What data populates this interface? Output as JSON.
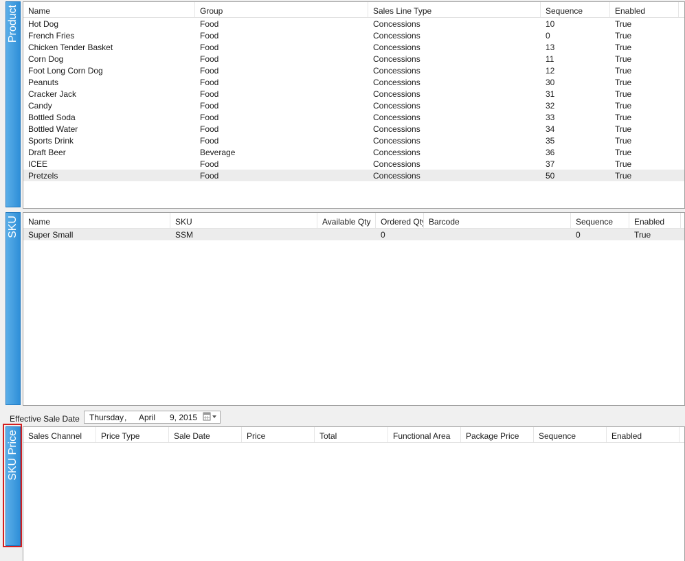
{
  "product": {
    "tab_label": "Product",
    "columns": [
      "Name",
      "Group",
      "Sales Line Type",
      "Sequence",
      "Enabled"
    ],
    "rows": [
      [
        "Hot Dog",
        "Food",
        "Concessions",
        "10",
        "True"
      ],
      [
        "French Fries",
        "Food",
        "Concessions",
        "0",
        "True"
      ],
      [
        "Chicken Tender Basket",
        "Food",
        "Concessions",
        "13",
        "True"
      ],
      [
        "Corn Dog",
        "Food",
        "Concessions",
        "11",
        "True"
      ],
      [
        "Foot Long Corn Dog",
        "Food",
        "Concessions",
        "12",
        "True"
      ],
      [
        "Peanuts",
        "Food",
        "Concessions",
        "30",
        "True"
      ],
      [
        "Cracker Jack",
        "Food",
        "Concessions",
        "31",
        "True"
      ],
      [
        "Candy",
        "Food",
        "Concessions",
        "32",
        "True"
      ],
      [
        "Bottled Soda",
        "Food",
        "Concessions",
        "33",
        "True"
      ],
      [
        "Bottled Water",
        "Food",
        "Concessions",
        "34",
        "True"
      ],
      [
        "Sports Drink",
        "Food",
        "Concessions",
        "35",
        "True"
      ],
      [
        "Draft Beer",
        "Beverage",
        "Concessions",
        "36",
        "True"
      ],
      [
        "ICEE",
        "Food",
        "Concessions",
        "37",
        "True"
      ],
      [
        "Pretzels",
        "Food",
        "Concessions",
        "50",
        "True"
      ]
    ],
    "selected_row": 13
  },
  "sku": {
    "tab_label": "SKU",
    "columns": [
      "Name",
      "SKU",
      "Available Qty",
      "Ordered Qty",
      "Barcode",
      "Sequence",
      "Enabled"
    ],
    "rows": [
      [
        "Super Small",
        "SSM",
        "",
        "0",
        "",
        "0",
        "True"
      ]
    ],
    "selected_row": 0
  },
  "effective_sale_date": {
    "label": "Effective Sale Date",
    "weekday": "Thursday",
    "separator": ",",
    "month": "April",
    "day_year": "9, 2015",
    "calendar_icon": "calendar-icon"
  },
  "sku_price": {
    "tab_label": "SKU Price",
    "columns": [
      "Sales Channel",
      "Price Type",
      "Sale Date",
      "Price",
      "Total",
      "Functional Area",
      "Package Price",
      "Sequence",
      "Enabled"
    ],
    "rows": []
  },
  "colors": {
    "tab_blue": "#2f8fd8",
    "highlight_red": "#d32020",
    "selected_row": "#ececec"
  }
}
